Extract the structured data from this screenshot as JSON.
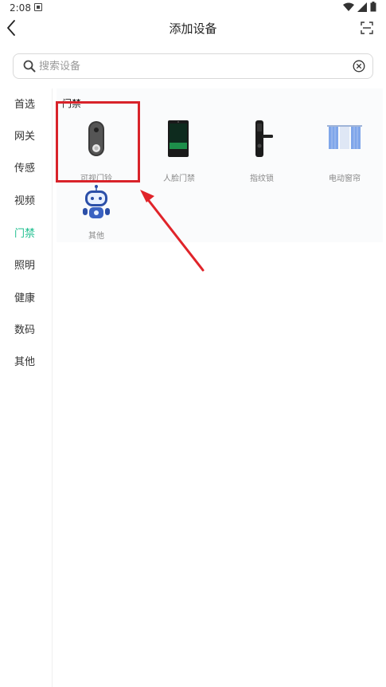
{
  "status_bar": {
    "time": "2:08"
  },
  "header": {
    "title": "添加设备"
  },
  "search": {
    "placeholder": "搜索设备",
    "value": ""
  },
  "sidebar": {
    "items": [
      {
        "label": "首选"
      },
      {
        "label": "网关"
      },
      {
        "label": "传感"
      },
      {
        "label": "视频"
      },
      {
        "label": "门禁",
        "active": true
      },
      {
        "label": "照明"
      },
      {
        "label": "健康"
      },
      {
        "label": "数码"
      },
      {
        "label": "其他"
      }
    ]
  },
  "section": {
    "title": "门禁",
    "devices": [
      {
        "label": "可视门铃",
        "icon": "video-doorbell-icon"
      },
      {
        "label": "人脸门禁",
        "icon": "face-access-icon"
      },
      {
        "label": "指纹锁",
        "icon": "fingerprint-lock-icon"
      },
      {
        "label": "电动窗帘",
        "icon": "curtain-icon"
      },
      {
        "label": "其他",
        "icon": "robot-icon"
      }
    ]
  },
  "colors": {
    "accent": "#1fbf8f",
    "highlight": "#d8232a"
  }
}
